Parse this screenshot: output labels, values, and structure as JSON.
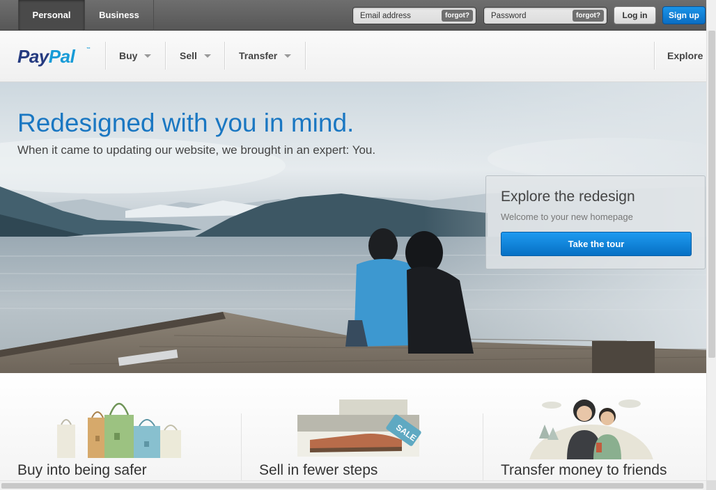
{
  "topbar": {
    "tabs": [
      {
        "label": "Personal",
        "active": true
      },
      {
        "label": "Business",
        "active": false
      }
    ],
    "email_placeholder": "Email address",
    "password_placeholder": "Password",
    "forgot_label": "forgot?",
    "login_label": "Log in",
    "signup_label": "Sign up"
  },
  "nav": {
    "logo_pay": "Pay",
    "logo_pal": "Pal",
    "logo_tm": "™",
    "items": [
      {
        "label": "Buy"
      },
      {
        "label": "Sell"
      },
      {
        "label": "Transfer"
      }
    ],
    "explore_label": "Explore"
  },
  "hero": {
    "title": "Redesigned with you in mind.",
    "subtitle": "When it came to updating our website, we brought in an expert: You.",
    "tour": {
      "title": "Explore the redesign",
      "subtitle": "Welcome to your new homepage",
      "button": "Take the tour"
    },
    "tag_text": "SALE"
  },
  "features": [
    {
      "title": "Buy into being safer",
      "icon": "shopping-bags-icon"
    },
    {
      "title": "Sell in fewer steps",
      "icon": "shoebox-sale-icon"
    },
    {
      "title": "Transfer money to friends",
      "icon": "friends-icon"
    }
  ],
  "colors": {
    "brand_dark": "#253b80",
    "brand_light": "#179bd7",
    "hero_title": "#1a77c2",
    "button_blue": "#0a6dc2"
  }
}
